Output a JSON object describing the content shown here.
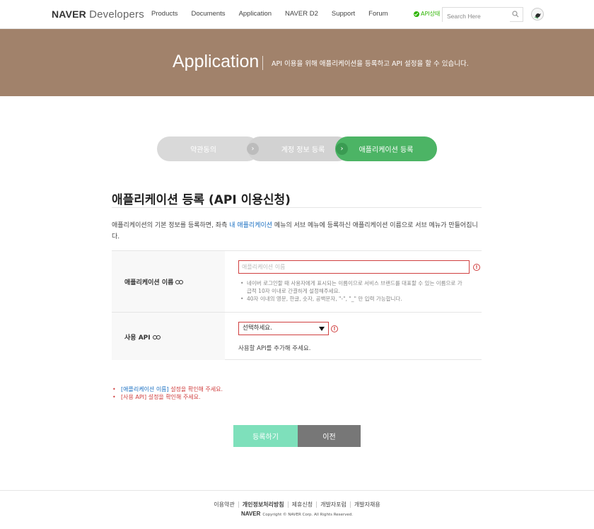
{
  "header": {
    "logo_brand": "NAVER",
    "logo_product": "Developers",
    "nav": [
      "Products",
      "Documents",
      "Application",
      "NAVER D2",
      "Support",
      "Forum"
    ],
    "api_status": "API상태",
    "search_placeholder": "Search Here"
  },
  "banner": {
    "title": "Application",
    "description": "API 이용을 위해 애플리케이션을 등록하고 API 설정을 할 수 있습니다."
  },
  "steps": {
    "step1": "약관동의",
    "step2": "계정 정보 등록",
    "step3": "애플리케이션 등록",
    "active": 3,
    "arrow": "›"
  },
  "section": {
    "title": "애플리케이션 등록 (API 이용신청)",
    "desc_before": "애플리케이션의 기본 정보를 등록하면, 좌측 ",
    "desc_link": "내 애플리케이션",
    "desc_after": " 메뉴의 서브 메뉴에 등록하신 애플리케이션 이름으로 서브 메뉴가 만들어집니다."
  },
  "form": {
    "app_name_label": "애플리케이션 이름",
    "app_name_placeholder": "애플리케이션 이름",
    "app_name_hint1": "네이버 로그인할 때 사용자에게 표시되는 이름이므로 서비스 브랜드를 대표할 수 있는 이름으로 가급적 10자 이내로 간결하게 설정해주세요.",
    "app_name_hint2": "40자 이내의 영문, 한글, 숫자, 공백문자, \"-\", \"_\" 만 입력 가능합니다.",
    "api_label": "사용 API",
    "api_select_value": "선택하세요.",
    "api_help": "사용할 API를 추가해 주세요.",
    "warn_glyph": "!"
  },
  "errors": {
    "e1_field": "[애플리케이션 이름]",
    "e1_msg": " 설정을 확인해 주세요.",
    "e2": "[사용 API] 설정을 확인해 주세요."
  },
  "buttons": {
    "submit": "등록하기",
    "prev": "이전"
  },
  "footer": {
    "links": [
      "이용약관",
      "개인정보처리방침",
      "제휴신청",
      "개발자포럼",
      "개발자채용"
    ],
    "brand": "NAVER",
    "copyright": "Copyright © NAVER Corp. All Rights Reserved."
  },
  "colors": {
    "banner": "#a1826b",
    "step_active": "#4cb465",
    "error": "#d04040",
    "link": "#1a6fc2",
    "submit": "#7ee0bb"
  }
}
